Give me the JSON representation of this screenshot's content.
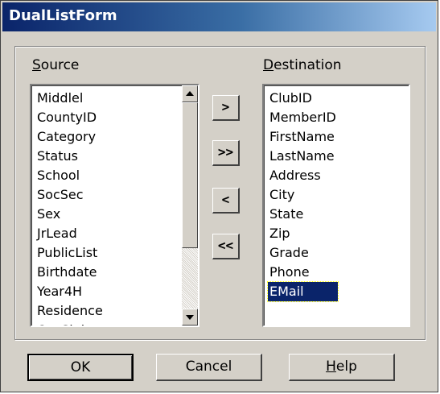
{
  "window": {
    "title": "DualListForm"
  },
  "source": {
    "label_accel": "S",
    "label_rest": "ource",
    "items": [
      "Middlel",
      "CountyID",
      "Category",
      "Status",
      "School",
      "SocSec",
      "Sex",
      "JrLead",
      "PublicList",
      "Birthdate",
      "Year4H",
      "Residence",
      "OrgClub"
    ]
  },
  "destination": {
    "label_accel": "D",
    "label_rest": "estination",
    "items": [
      "ClubID",
      "MemberID",
      "FirstName",
      "LastName",
      "Address",
      "City",
      "State",
      "Zip",
      "Grade",
      "Phone",
      "EMail"
    ],
    "selected_index": 10
  },
  "move_buttons": {
    "include": ">",
    "include_all": ">>",
    "exclude": "<",
    "exclude_all": "<<"
  },
  "buttons": {
    "ok": "OK",
    "cancel": "Cancel",
    "help_accel": "H",
    "help_rest": "elp"
  }
}
